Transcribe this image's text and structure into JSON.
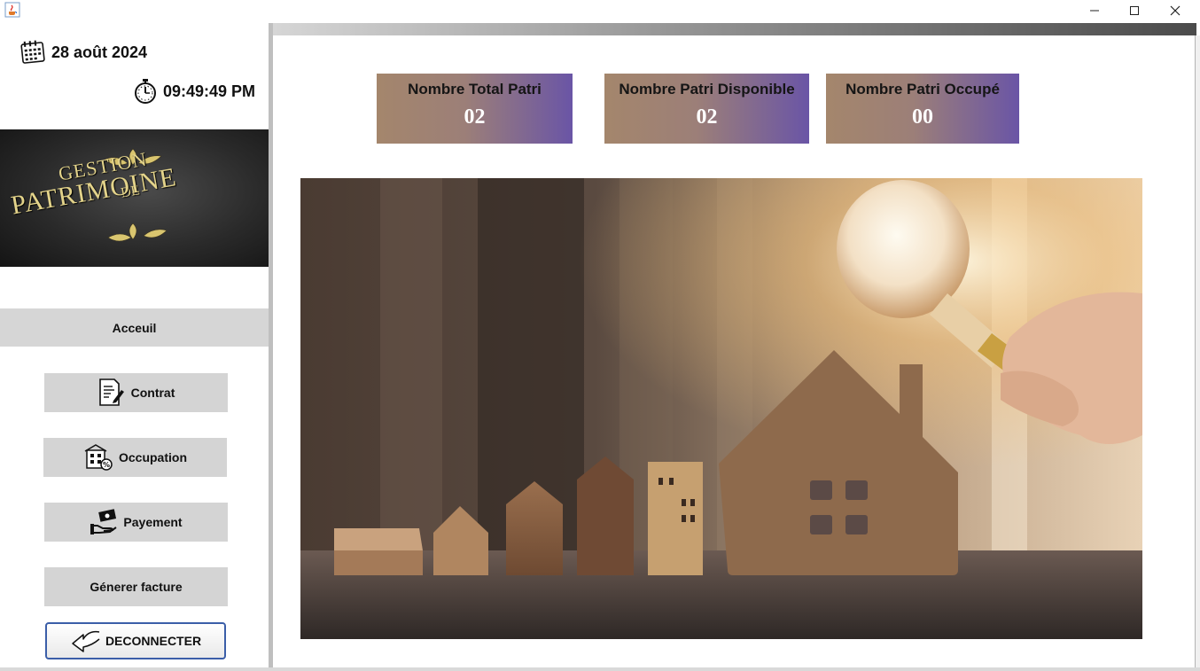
{
  "window": {
    "app_icon": "java-cup-icon",
    "controls": [
      "minimize",
      "maximize",
      "close"
    ]
  },
  "sidebar": {
    "date": "28 août 2024",
    "time": "09:49:49 PM",
    "logo": {
      "line1": "GESTION",
      "line2": "DE",
      "line3": "PATRIMOINE"
    },
    "home_label": "Acceuil",
    "buttons": {
      "contrat": "Contrat",
      "occupation": "Occupation",
      "payement": "Payement",
      "facture": "Génerer facture",
      "deconnecter": "DECONNECTER"
    }
  },
  "stats": [
    {
      "label": "Nombre Total Patri",
      "value": "02"
    },
    {
      "label": "Nombre Patri Disponible",
      "value": "02"
    },
    {
      "label": "Nombre Patri Occupé",
      "value": "00"
    }
  ],
  "colors": {
    "card_start": "#a4866c",
    "card_end": "#6a55a6",
    "nav_bg": "#d4d4d4",
    "logo_gold": "#e3d38a",
    "deco_border": "#3b5ea8"
  }
}
